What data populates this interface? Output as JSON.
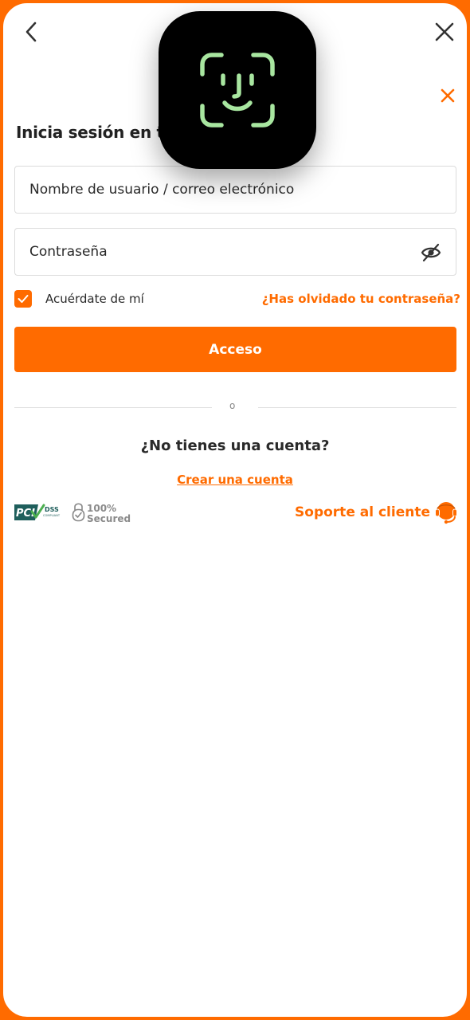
{
  "header": {
    "title": "Inicia sesión en tu"
  },
  "form": {
    "username_placeholder": "Nombre de usuario / correo electrónico",
    "password_placeholder": "Contraseña",
    "remember_label": "Acuérdate de mí",
    "remember_checked": true,
    "forgot_label": "¿Has olvidado tu contraseña?",
    "login_label": "Acceso"
  },
  "divider": {
    "text": "o"
  },
  "signup": {
    "question": "¿No tienes una cuenta?",
    "link": "Crear una cuenta"
  },
  "badges": {
    "pci_text": "PCI",
    "dss_text": "DSS",
    "compliant_text": "COMPLIANT",
    "secured_percent": "100%",
    "secured_text": "Secured"
  },
  "support": {
    "label": "Soporte al cliente"
  },
  "icons": [
    "back-arrow-icon",
    "close-icon",
    "face-id-icon",
    "eye-off-icon",
    "check-icon",
    "pci-dss-logo",
    "secured-lock-icon",
    "headset-icon"
  ],
  "colors": {
    "accent": "#ff6b00",
    "face_id_green": "#a8e6a0",
    "text": "#2a2a2a"
  }
}
